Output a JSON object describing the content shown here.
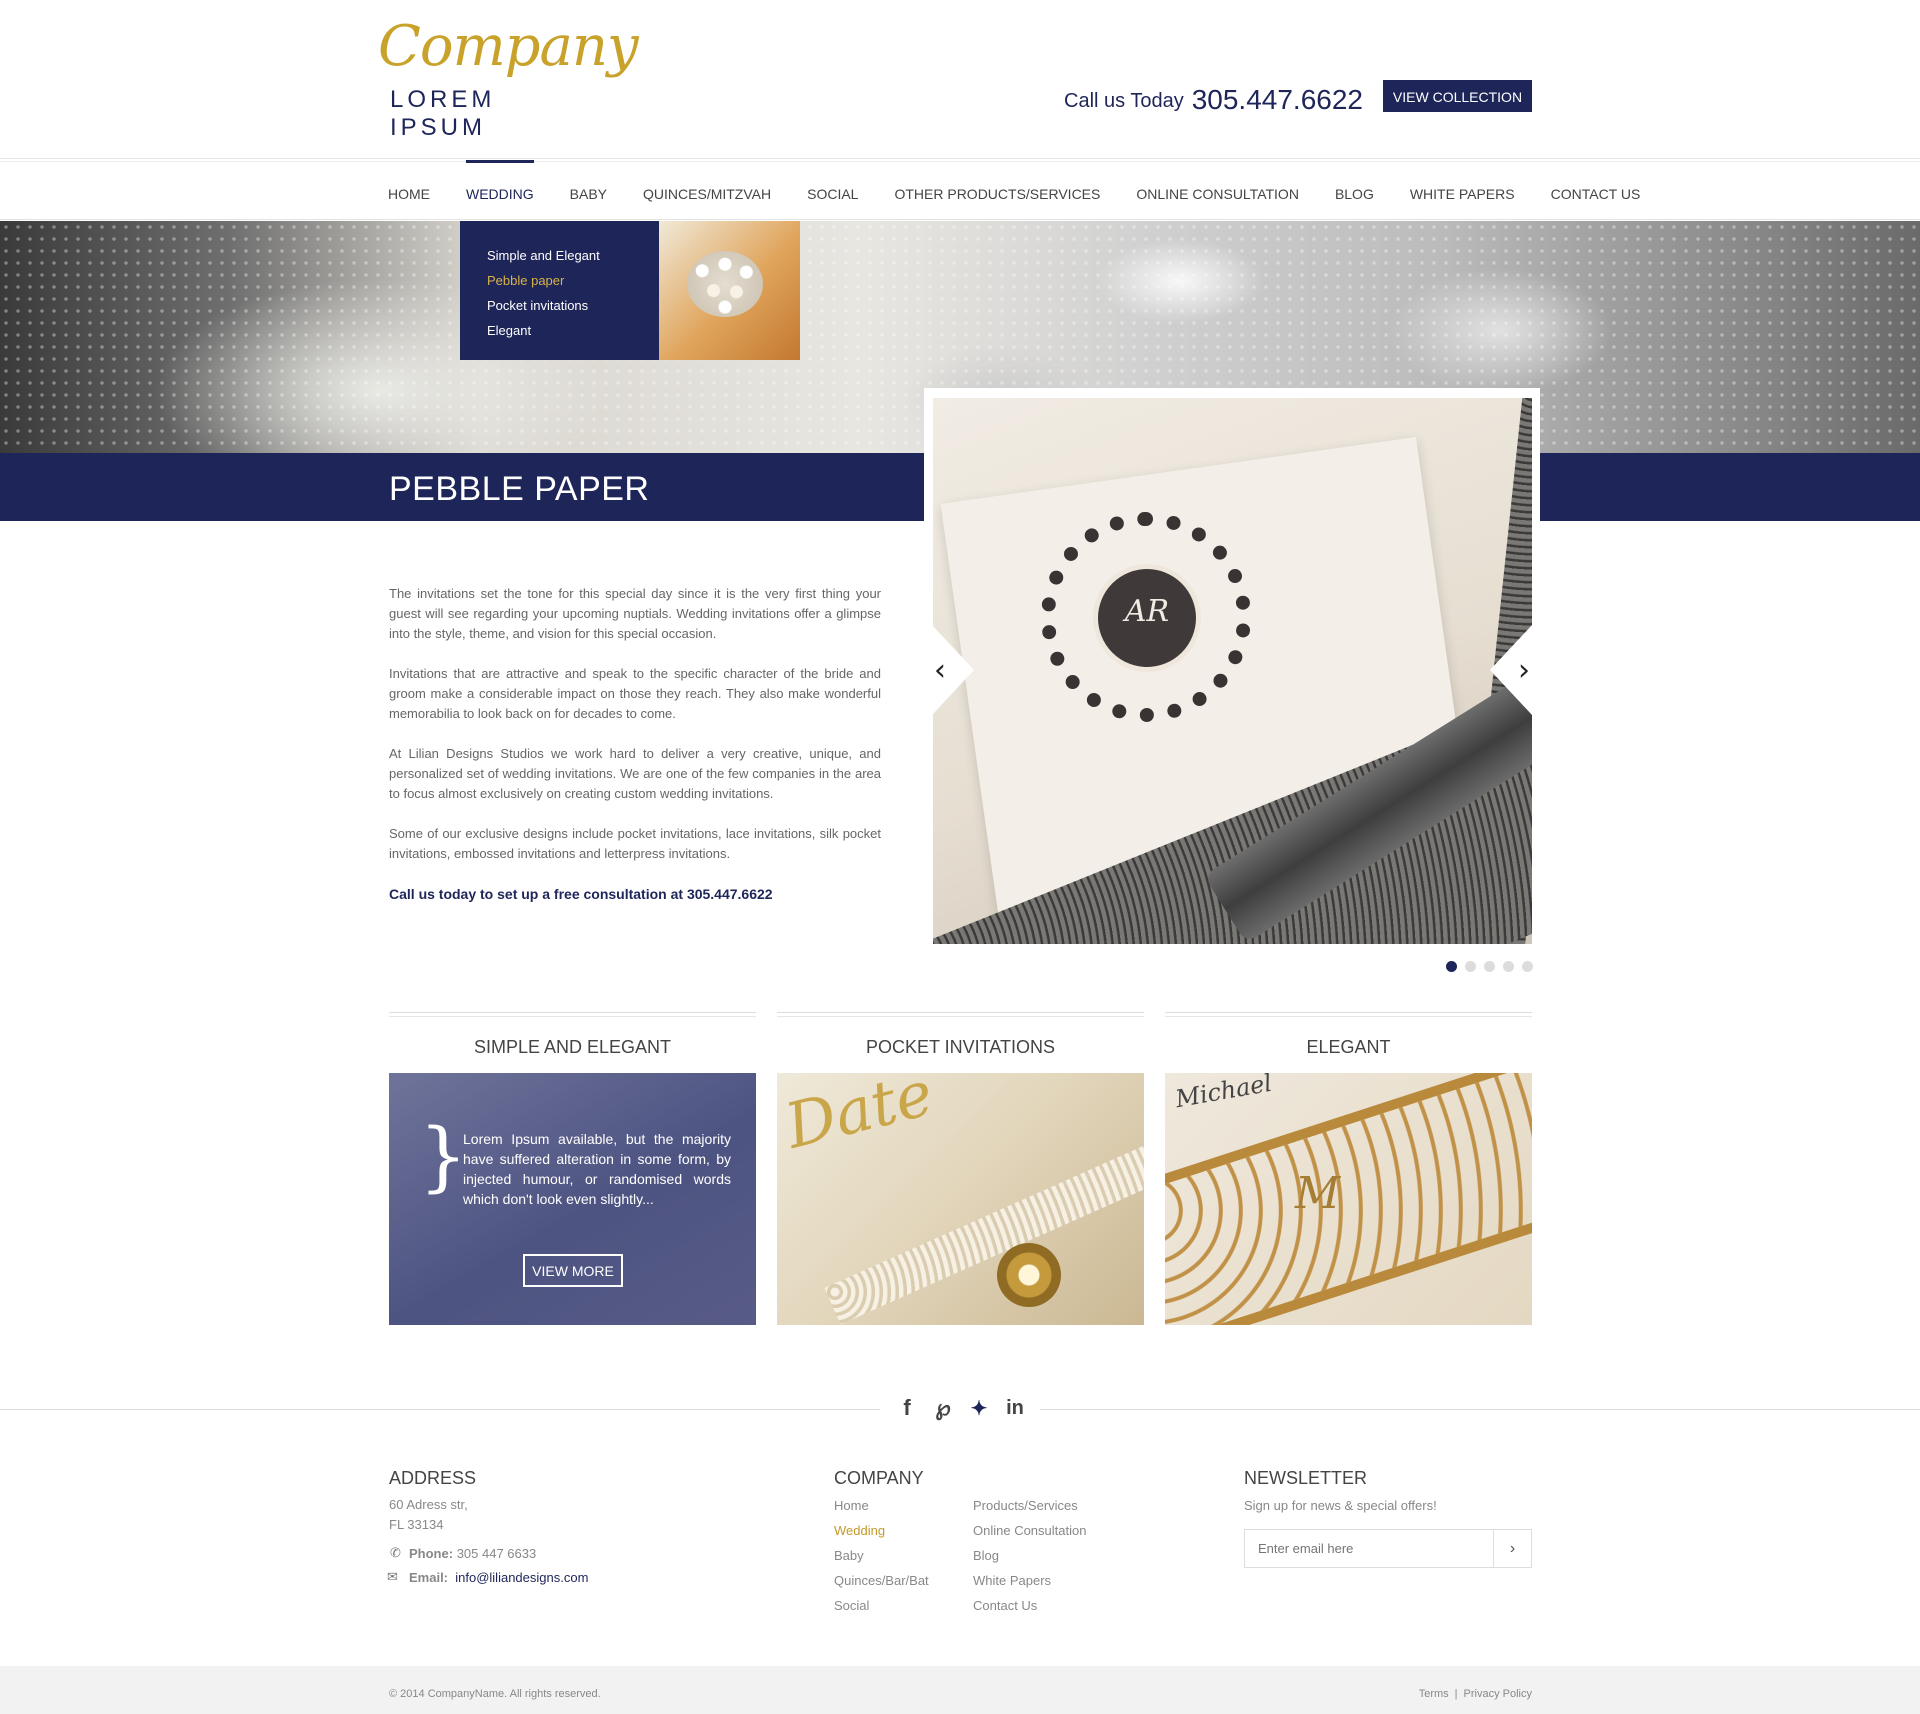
{
  "header": {
    "logo_script": "Company",
    "logo_sub": "LOREM IPSUM",
    "call_label": "Call us Today",
    "phone": "305.447.6622",
    "view_collection": "VIEW COLLECTION"
  },
  "nav": {
    "items": [
      "HOME",
      "WEDDING",
      "BABY",
      "QUINCES/MITZVAH",
      "SOCIAL",
      "OTHER PRODUCTS/SERVICES",
      "ONLINE CONSULTATION",
      "BLOG",
      "WHITE PAPERS",
      "CONTACT US"
    ],
    "active": "WEDDING"
  },
  "dropdown": {
    "items": [
      "Simple and Elegant",
      "Pebble paper",
      "Pocket invitations",
      "Elegant"
    ],
    "current": "Pebble paper"
  },
  "page": {
    "title": "PEBBLE PAPER"
  },
  "content": {
    "p1": "The invitations set the tone for this special day since it is the very first thing your guest will see regarding your upcoming nuptials. Wedding invitations offer a glimpse into the style, theme, and vision for this special occasion.",
    "p2": "Invitations that are attractive and speak to the specific character of the bride and groom make a considerable impact on those they reach. They also make wonderful memorabilia to look back on for decades to come.",
    "p3": "At Lilian Designs Studios we work hard to deliver a very creative, unique, and personalized set of wedding invitations. We are one of the few companies in the area to focus almost exclusively on creating custom wedding invitations.",
    "p4": "Some of our exclusive designs include pocket invitations, lace invitations, silk pocket invitations, embossed invitations and letterpress invitations.",
    "cta": "Call us today to set up a free consultation at 305.447.6622"
  },
  "slider": {
    "slides": 5,
    "current": 1
  },
  "features": [
    {
      "title": "SIMPLE AND ELEGANT",
      "blurb": "Lorem Ipsum available, but the majority have suffered alteration in some form, by injected humour, or randomised words which don't look even slightly...",
      "button": "VIEW MORE"
    },
    {
      "title": "POCKET INVITATIONS"
    },
    {
      "title": "ELEGANT"
    }
  ],
  "social": {
    "icons": [
      "facebook-icon",
      "pinterest-icon",
      "twitter-icon",
      "linkedin-icon"
    ]
  },
  "footer": {
    "address": {
      "title": "ADDRESS",
      "line1": "60 Adress str,",
      "line2": "FL 33134",
      "phone_label": "Phone:",
      "phone": "305 447 6633",
      "email_label": "Email:",
      "email": "info@liliandesigns.com"
    },
    "company": {
      "title": "COMPANY",
      "col1": [
        "Home",
        "Wedding",
        "Baby",
        "Quinces/Bar/Bat",
        "Social"
      ],
      "col2": [
        "Products/Services",
        "Online Consultation",
        "Blog",
        "White Papers",
        "Contact Us"
      ],
      "current": "Wedding"
    },
    "newsletter": {
      "title": "NEWSLETTER",
      "subtitle": "Sign up for news & special offers!",
      "placeholder": "Enter email here"
    }
  },
  "bottom": {
    "copyright": "© 2014 CompanyName. All rights reserved.",
    "terms": "Terms",
    "separator": "|",
    "privacy": "Privacy Policy"
  },
  "colors": {
    "navy": "#1e2559",
    "gold": "#c49a2a"
  }
}
